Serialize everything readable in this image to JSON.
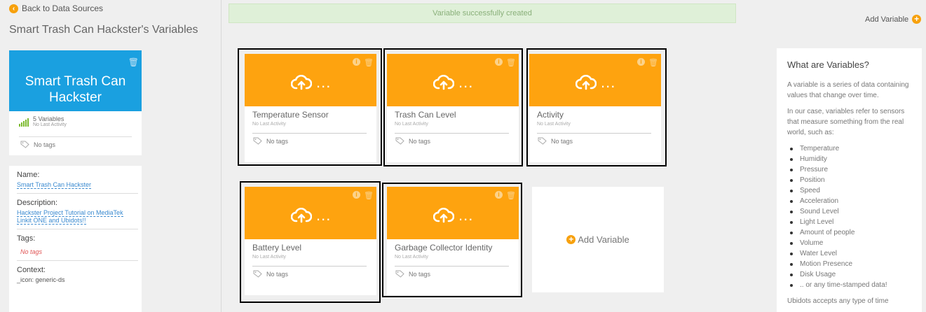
{
  "sidebar": {
    "back_label": "Back to Data Sources",
    "title": "Smart Trash Can Hackster's Variables",
    "card": {
      "name_line1": "Smart Trash Can",
      "name_line2": "Hackster",
      "variables_count": "5 Variables",
      "last_activity": "No Last Activity",
      "tags": "No tags",
      "accent_color": "#1aa0e0"
    },
    "properties": {
      "name_label": "Name:",
      "name_value": "Smart Trash Can Hackster",
      "description_label": "Description:",
      "description_value": "Hackster Project Tutorial on MediaTek Linkit ONE and Ubidots!!",
      "tags_label": "Tags:",
      "tags_value": "No tags",
      "context_label": "Context:",
      "context_value": "_icon: generic-ds"
    }
  },
  "main": {
    "success_message": "Variable successfully created",
    "add_variable_label": "Add Variable",
    "variables": [
      {
        "name": "Temperature Sensor",
        "activity": "No Last Activity",
        "tags": "No tags"
      },
      {
        "name": "Trash Can Level",
        "activity": "No Last Activity",
        "tags": "No tags"
      },
      {
        "name": "Activity",
        "activity": "No Last Activity",
        "tags": "No tags"
      },
      {
        "name": "Battery Level",
        "activity": "No Last Activity",
        "tags": "No tags"
      },
      {
        "name": "Garbage Collector Identity",
        "activity": "No Last Activity",
        "tags": "No tags"
      }
    ],
    "card_dots": "...",
    "add_card_label": "Add Variable",
    "accent_color": "#fea30f"
  },
  "info_panel": {
    "title": "What are Variables?",
    "para1": "A variable is a series of data containing values that change over time.",
    "para2": "In our case, variables refer to sensors that measure something from the real world, such as:",
    "items": [
      "Temperature",
      "Humidity",
      "Pressure",
      "Position",
      "Speed",
      "Acceleration",
      "Sound Level",
      "Light Level",
      "Amount of people",
      "Volume",
      "Water Level",
      "Motion Presence",
      "Disk Usage",
      ".. or any time-stamped data!"
    ],
    "para3": "Ubidots accepts any type of time"
  },
  "icons": {
    "back": "chevron-left-icon",
    "trash": "trash-icon",
    "info": "info-icon",
    "cloud": "cloud-upload-icon",
    "tag": "tag-icon",
    "plus": "plus-circle-icon",
    "signal": "signal-bars-icon"
  }
}
